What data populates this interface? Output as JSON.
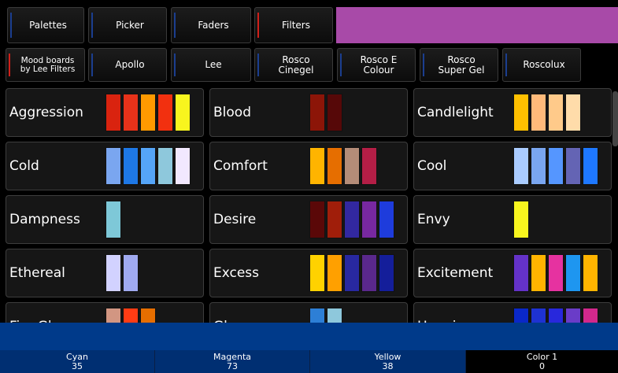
{
  "top_tabs": [
    {
      "label": "Palettes",
      "indicator": "blue"
    },
    {
      "label": "Picker",
      "indicator": "blue"
    },
    {
      "label": "Faders",
      "indicator": "blue"
    },
    {
      "label": "Filters",
      "indicator": "red"
    }
  ],
  "filter_tabs": [
    {
      "label": "Mood boards\nby Lee Filters",
      "indicator": "red"
    },
    {
      "label": "Apollo",
      "indicator": "blue"
    },
    {
      "label": "Lee",
      "indicator": "blue"
    },
    {
      "label": "Rosco\nCinegel",
      "indicator": "blue"
    },
    {
      "label": "Rosco E\nColour",
      "indicator": "blue"
    },
    {
      "label": "Rosco\nSuper Gel",
      "indicator": "blue"
    },
    {
      "label": "Roscolux",
      "indicator": "blue"
    }
  ],
  "header_accent_color": "#a84aa8",
  "moods": [
    {
      "name": "Aggression",
      "colors": [
        "#d9230f",
        "#e8321a",
        "#ff9a00",
        "#f2300f",
        "#f8f51e"
      ]
    },
    {
      "name": "Blood",
      "colors": [
        "#8c1508",
        "#560808"
      ]
    },
    {
      "name": "Candlelight",
      "colors": [
        "#ffc000",
        "#ffba7a",
        "#ffca8a",
        "#ffdcaa"
      ]
    },
    {
      "name": "Cold",
      "colors": [
        "#7aa6f0",
        "#1e78e6",
        "#55a5f8",
        "#8ec8dc",
        "#f2e8ff"
      ]
    },
    {
      "name": "Comfort",
      "colors": [
        "#ffb400",
        "#e66e00",
        "#b48c78",
        "#b41e46"
      ]
    },
    {
      "name": "Cool",
      "colors": [
        "#aaccff",
        "#7aa6f0",
        "#5596ff",
        "#6464b4",
        "#1e78ff"
      ]
    },
    {
      "name": "Dampness",
      "colors": [
        "#7ec8d8"
      ]
    },
    {
      "name": "Desire",
      "colors": [
        "#5a0808",
        "#a01e0a",
        "#3228a0",
        "#7828a0",
        "#1e3cdc"
      ]
    },
    {
      "name": "Envy",
      "colors": [
        "#f8f51e"
      ]
    },
    {
      "name": "Ethereal",
      "colors": [
        "#d2d2ff",
        "#a0aaf0"
      ]
    },
    {
      "name": "Excess",
      "colors": [
        "#ffd200",
        "#ffa000",
        "#2828a0",
        "#5a288c",
        "#141e9a"
      ]
    },
    {
      "name": "Excitement",
      "colors": [
        "#6432c8",
        "#ffb400",
        "#e632a0",
        "#1e96f0",
        "#ffb400"
      ]
    },
    {
      "name": "Fire Glow",
      "colors": [
        "#d29682",
        "#ff3c14",
        "#e66e00"
      ]
    },
    {
      "name": "Gloom",
      "colors": [
        "#2d7fd6",
        "#8ec8dc"
      ]
    },
    {
      "name": "Happiness",
      "colors": [
        "#0a28c8",
        "#1e32d2",
        "#2828dc",
        "#6a3cc8",
        "#d2288c"
      ]
    }
  ],
  "status": [
    {
      "label": "Cyan",
      "value": "35"
    },
    {
      "label": "Magenta",
      "value": "73"
    },
    {
      "label": "Yellow",
      "value": "38"
    },
    {
      "label": "Color 1",
      "value": "0"
    }
  ]
}
